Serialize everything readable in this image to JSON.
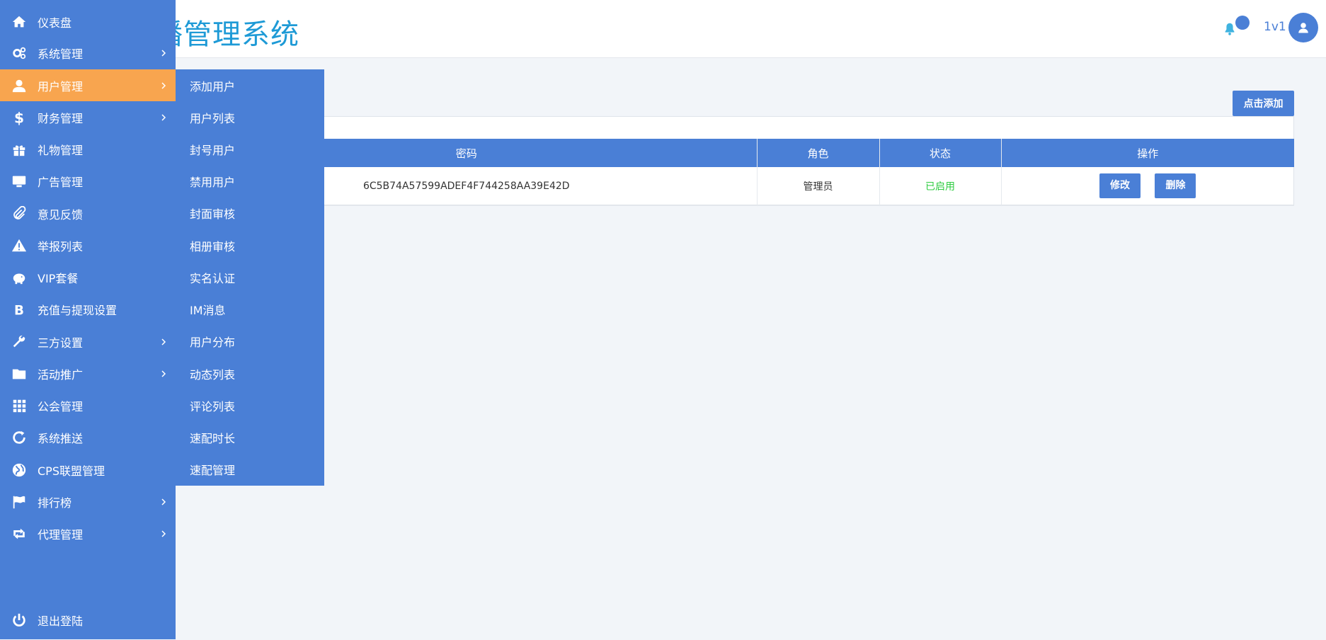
{
  "header": {
    "title": "播管理系统",
    "user_name": "1v1"
  },
  "main": {
    "add_button": "点击添加",
    "table": {
      "headers": [
        "密码",
        "角色",
        "状态",
        "操作"
      ],
      "rows": [
        {
          "password": "6C5B74A57599ADEF4F744258AA39E42D",
          "role": "管理员",
          "status": "已启用",
          "edit": "修改",
          "delete": "删除"
        }
      ]
    }
  },
  "sidebar": {
    "items": [
      {
        "label": "仪表盘",
        "icon": "home-icon"
      },
      {
        "label": "系统管理",
        "icon": "gears-icon",
        "has_submenu": true
      },
      {
        "label": "用户管理",
        "icon": "user-icon",
        "has_submenu": true,
        "active": true
      },
      {
        "label": "财务管理",
        "icon": "dollar-icon",
        "has_submenu": true
      },
      {
        "label": "礼物管理",
        "icon": "gift-icon"
      },
      {
        "label": "广告管理",
        "icon": "desktop-icon"
      },
      {
        "label": "意见反馈",
        "icon": "paperclip-icon"
      },
      {
        "label": "举报列表",
        "icon": "warning-icon"
      },
      {
        "label": "VIP套餐",
        "icon": "piggy-bank-icon"
      },
      {
        "label": "充值与提现设置",
        "icon": "bitcoin-icon"
      },
      {
        "label": "三方设置",
        "icon": "wrench-icon",
        "has_submenu": true
      },
      {
        "label": "活动推广",
        "icon": "folder-icon",
        "has_submenu": true
      },
      {
        "label": "公会管理",
        "icon": "grid-icon"
      },
      {
        "label": "系统推送",
        "icon": "refresh-icon"
      },
      {
        "label": "CPS联盟管理",
        "icon": "globe-icon"
      },
      {
        "label": "排行榜",
        "icon": "flag-icon",
        "has_submenu": true
      },
      {
        "label": "代理管理",
        "icon": "retweet-icon",
        "has_submenu": true
      }
    ],
    "logout": {
      "label": "退出登陆",
      "icon": "power-icon"
    }
  },
  "submenu": {
    "items": [
      "添加用户",
      "用户列表",
      "封号用户",
      "禁用用户",
      "封面审核",
      "相册审核",
      "实名认证",
      "IM消息",
      "用户分布",
      "动态列表",
      "评论列表",
      "速配时长",
      "速配管理"
    ]
  },
  "colors": {
    "primary": "#4a7fd6",
    "active": "#f8a54f",
    "title": "#1e9ad6",
    "status_enabled": "#2ecc40"
  }
}
